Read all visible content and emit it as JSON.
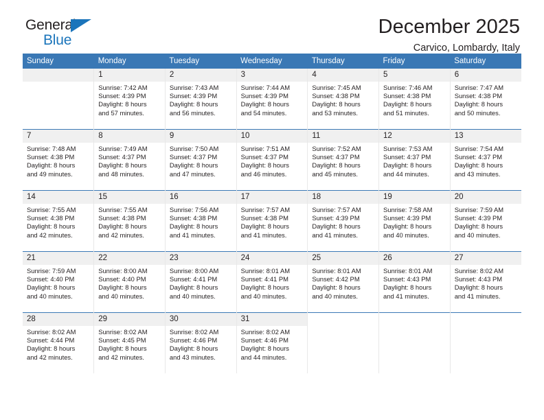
{
  "brand": {
    "name_part1": "General",
    "name_part2": "Blue",
    "accent_color": "#1b75bb"
  },
  "header": {
    "month_title": "December 2025",
    "location": "Carvico, Lombardy, Italy"
  },
  "calendar": {
    "header_bg": "#3a78b5",
    "daynum_bg": "#f0f0f0",
    "weekday_headers": [
      "Sunday",
      "Monday",
      "Tuesday",
      "Wednesday",
      "Thursday",
      "Friday",
      "Saturday"
    ],
    "weeks": [
      [
        {
          "day": "",
          "empty": true
        },
        {
          "day": "1",
          "sunrise": "Sunrise: 7:42 AM",
          "sunset": "Sunset: 4:39 PM",
          "daylight_line1": "Daylight: 8 hours",
          "daylight_line2": "and 57 minutes."
        },
        {
          "day": "2",
          "sunrise": "Sunrise: 7:43 AM",
          "sunset": "Sunset: 4:39 PM",
          "daylight_line1": "Daylight: 8 hours",
          "daylight_line2": "and 56 minutes."
        },
        {
          "day": "3",
          "sunrise": "Sunrise: 7:44 AM",
          "sunset": "Sunset: 4:39 PM",
          "daylight_line1": "Daylight: 8 hours",
          "daylight_line2": "and 54 minutes."
        },
        {
          "day": "4",
          "sunrise": "Sunrise: 7:45 AM",
          "sunset": "Sunset: 4:38 PM",
          "daylight_line1": "Daylight: 8 hours",
          "daylight_line2": "and 53 minutes."
        },
        {
          "day": "5",
          "sunrise": "Sunrise: 7:46 AM",
          "sunset": "Sunset: 4:38 PM",
          "daylight_line1": "Daylight: 8 hours",
          "daylight_line2": "and 51 minutes."
        },
        {
          "day": "6",
          "sunrise": "Sunrise: 7:47 AM",
          "sunset": "Sunset: 4:38 PM",
          "daylight_line1": "Daylight: 8 hours",
          "daylight_line2": "and 50 minutes."
        }
      ],
      [
        {
          "day": "7",
          "sunrise": "Sunrise: 7:48 AM",
          "sunset": "Sunset: 4:38 PM",
          "daylight_line1": "Daylight: 8 hours",
          "daylight_line2": "and 49 minutes."
        },
        {
          "day": "8",
          "sunrise": "Sunrise: 7:49 AM",
          "sunset": "Sunset: 4:37 PM",
          "daylight_line1": "Daylight: 8 hours",
          "daylight_line2": "and 48 minutes."
        },
        {
          "day": "9",
          "sunrise": "Sunrise: 7:50 AM",
          "sunset": "Sunset: 4:37 PM",
          "daylight_line1": "Daylight: 8 hours",
          "daylight_line2": "and 47 minutes."
        },
        {
          "day": "10",
          "sunrise": "Sunrise: 7:51 AM",
          "sunset": "Sunset: 4:37 PM",
          "daylight_line1": "Daylight: 8 hours",
          "daylight_line2": "and 46 minutes."
        },
        {
          "day": "11",
          "sunrise": "Sunrise: 7:52 AM",
          "sunset": "Sunset: 4:37 PM",
          "daylight_line1": "Daylight: 8 hours",
          "daylight_line2": "and 45 minutes."
        },
        {
          "day": "12",
          "sunrise": "Sunrise: 7:53 AM",
          "sunset": "Sunset: 4:37 PM",
          "daylight_line1": "Daylight: 8 hours",
          "daylight_line2": "and 44 minutes."
        },
        {
          "day": "13",
          "sunrise": "Sunrise: 7:54 AM",
          "sunset": "Sunset: 4:37 PM",
          "daylight_line1": "Daylight: 8 hours",
          "daylight_line2": "and 43 minutes."
        }
      ],
      [
        {
          "day": "14",
          "sunrise": "Sunrise: 7:55 AM",
          "sunset": "Sunset: 4:38 PM",
          "daylight_line1": "Daylight: 8 hours",
          "daylight_line2": "and 42 minutes."
        },
        {
          "day": "15",
          "sunrise": "Sunrise: 7:55 AM",
          "sunset": "Sunset: 4:38 PM",
          "daylight_line1": "Daylight: 8 hours",
          "daylight_line2": "and 42 minutes."
        },
        {
          "day": "16",
          "sunrise": "Sunrise: 7:56 AM",
          "sunset": "Sunset: 4:38 PM",
          "daylight_line1": "Daylight: 8 hours",
          "daylight_line2": "and 41 minutes."
        },
        {
          "day": "17",
          "sunrise": "Sunrise: 7:57 AM",
          "sunset": "Sunset: 4:38 PM",
          "daylight_line1": "Daylight: 8 hours",
          "daylight_line2": "and 41 minutes."
        },
        {
          "day": "18",
          "sunrise": "Sunrise: 7:57 AM",
          "sunset": "Sunset: 4:39 PM",
          "daylight_line1": "Daylight: 8 hours",
          "daylight_line2": "and 41 minutes."
        },
        {
          "day": "19",
          "sunrise": "Sunrise: 7:58 AM",
          "sunset": "Sunset: 4:39 PM",
          "daylight_line1": "Daylight: 8 hours",
          "daylight_line2": "and 40 minutes."
        },
        {
          "day": "20",
          "sunrise": "Sunrise: 7:59 AM",
          "sunset": "Sunset: 4:39 PM",
          "daylight_line1": "Daylight: 8 hours",
          "daylight_line2": "and 40 minutes."
        }
      ],
      [
        {
          "day": "21",
          "sunrise": "Sunrise: 7:59 AM",
          "sunset": "Sunset: 4:40 PM",
          "daylight_line1": "Daylight: 8 hours",
          "daylight_line2": "and 40 minutes."
        },
        {
          "day": "22",
          "sunrise": "Sunrise: 8:00 AM",
          "sunset": "Sunset: 4:40 PM",
          "daylight_line1": "Daylight: 8 hours",
          "daylight_line2": "and 40 minutes."
        },
        {
          "day": "23",
          "sunrise": "Sunrise: 8:00 AM",
          "sunset": "Sunset: 4:41 PM",
          "daylight_line1": "Daylight: 8 hours",
          "daylight_line2": "and 40 minutes."
        },
        {
          "day": "24",
          "sunrise": "Sunrise: 8:01 AM",
          "sunset": "Sunset: 4:41 PM",
          "daylight_line1": "Daylight: 8 hours",
          "daylight_line2": "and 40 minutes."
        },
        {
          "day": "25",
          "sunrise": "Sunrise: 8:01 AM",
          "sunset": "Sunset: 4:42 PM",
          "daylight_line1": "Daylight: 8 hours",
          "daylight_line2": "and 40 minutes."
        },
        {
          "day": "26",
          "sunrise": "Sunrise: 8:01 AM",
          "sunset": "Sunset: 4:43 PM",
          "daylight_line1": "Daylight: 8 hours",
          "daylight_line2": "and 41 minutes."
        },
        {
          "day": "27",
          "sunrise": "Sunrise: 8:02 AM",
          "sunset": "Sunset: 4:43 PM",
          "daylight_line1": "Daylight: 8 hours",
          "daylight_line2": "and 41 minutes."
        }
      ],
      [
        {
          "day": "28",
          "sunrise": "Sunrise: 8:02 AM",
          "sunset": "Sunset: 4:44 PM",
          "daylight_line1": "Daylight: 8 hours",
          "daylight_line2": "and 42 minutes."
        },
        {
          "day": "29",
          "sunrise": "Sunrise: 8:02 AM",
          "sunset": "Sunset: 4:45 PM",
          "daylight_line1": "Daylight: 8 hours",
          "daylight_line2": "and 42 minutes."
        },
        {
          "day": "30",
          "sunrise": "Sunrise: 8:02 AM",
          "sunset": "Sunset: 4:46 PM",
          "daylight_line1": "Daylight: 8 hours",
          "daylight_line2": "and 43 minutes."
        },
        {
          "day": "31",
          "sunrise": "Sunrise: 8:02 AM",
          "sunset": "Sunset: 4:46 PM",
          "daylight_line1": "Daylight: 8 hours",
          "daylight_line2": "and 44 minutes."
        },
        {
          "day": "",
          "blank": true
        },
        {
          "day": "",
          "blank": true
        },
        {
          "day": "",
          "blank": true
        }
      ]
    ]
  }
}
